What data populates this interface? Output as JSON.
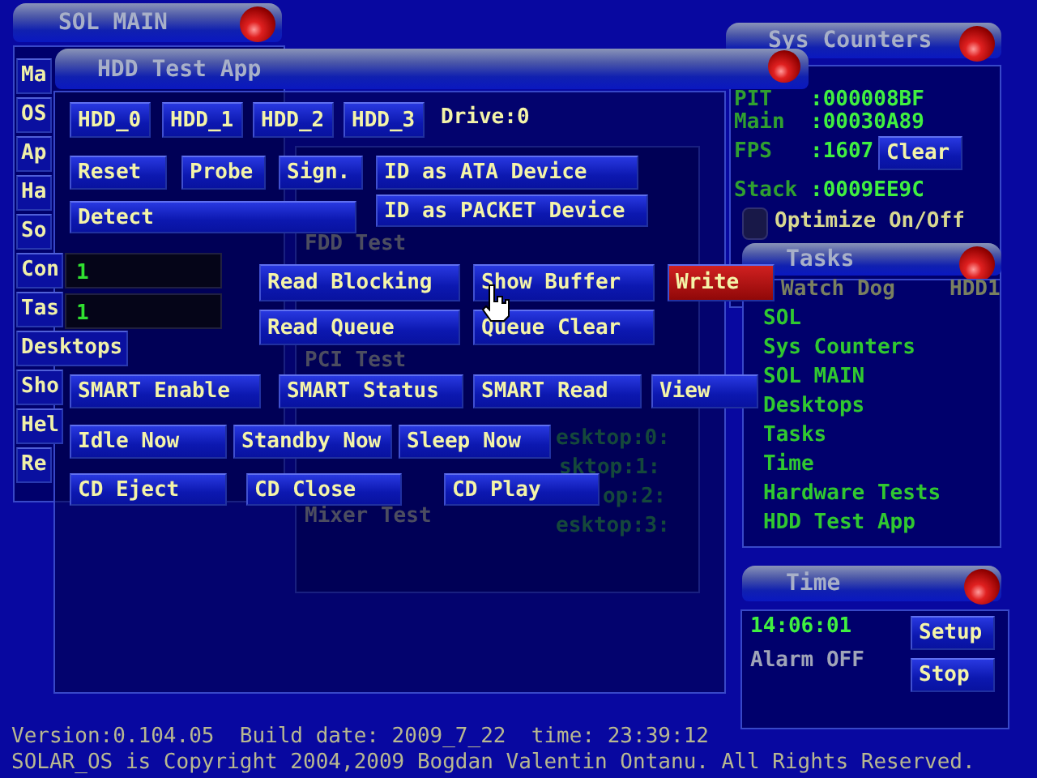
{
  "sol_main": {
    "title": "SOL MAIN",
    "items": [
      "Ma",
      "OS",
      "Ap",
      "Ha",
      "So",
      "Con",
      "Tas",
      "Desktops",
      "Sho",
      "Hel",
      "Re"
    ]
  },
  "hardware_tests_window": {
    "items": [
      "FDD Test",
      "PCI Test",
      "Mixer Test"
    ]
  },
  "desktops_window": {
    "items": [
      "esktop:0:",
      "sktop:1:",
      "op:2:",
      "esktop:3:"
    ]
  },
  "hdd_test_app": {
    "title": "HDD Test App",
    "drive_buttons": [
      "HDD_0",
      "HDD_1",
      "HDD_2",
      "HDD_3"
    ],
    "drive_label": "Drive:0",
    "buttons": [
      {
        "label": "Reset",
        "kind": "normal"
      },
      {
        "label": "Probe",
        "kind": "normal"
      },
      {
        "label": "Sign.",
        "kind": "normal"
      },
      {
        "label": "ID as ATA Device",
        "kind": "normal"
      },
      {
        "label": "Detect",
        "kind": "normal"
      },
      {
        "label": "ID as PACKET Device",
        "kind": "normal"
      },
      {
        "label": "Read Blocking",
        "kind": "normal"
      },
      {
        "label": "Show Buffer",
        "kind": "normal"
      },
      {
        "label": "Write",
        "kind": "danger"
      },
      {
        "label": "Read Queue",
        "kind": "normal"
      },
      {
        "label": "Queue Clear",
        "kind": "normal"
      },
      {
        "label": "SMART Enable",
        "kind": "normal"
      },
      {
        "label": "SMART Status",
        "kind": "normal"
      },
      {
        "label": "SMART Read",
        "kind": "normal"
      },
      {
        "label": "View",
        "kind": "normal"
      },
      {
        "label": "Idle Now",
        "kind": "normal"
      },
      {
        "label": "Standby Now",
        "kind": "normal"
      },
      {
        "label": "Sleep Now",
        "kind": "normal"
      },
      {
        "label": "CD Eject",
        "kind": "normal"
      },
      {
        "label": "CD Close",
        "kind": "normal"
      },
      {
        "label": "CD Play",
        "kind": "normal"
      }
    ],
    "outputs": [
      "1",
      "1"
    ]
  },
  "sys_counters": {
    "title": "Sys Counters",
    "counters": [
      {
        "label": "PIT",
        "value": ":000008BF"
      },
      {
        "label": "Main",
        "value": ":00030A89"
      },
      {
        "label": "FPS",
        "value": ":1607"
      },
      {
        "label": "Stack",
        "value": ":0009EE9C"
      }
    ],
    "clear_button": "Clear",
    "optimize": {
      "label": "Optimize On/Off",
      "checked": false
    }
  },
  "tasks": {
    "title": "Tasks",
    "top_row": [
      "Watch Dog",
      "HDD1"
    ],
    "items": [
      "SOL",
      "Sys Counters",
      "SOL MAIN",
      "Desktops",
      "Tasks",
      "Time",
      "Hardware Tests",
      "HDD Test App"
    ]
  },
  "time": {
    "title": "Time",
    "clock": "14:06:01",
    "alarm": "Alarm OFF",
    "buttons": [
      "Setup",
      "Stop"
    ]
  },
  "status": [
    "Version:0.104.05  Build date: 2009_7_22  time: 23:39:12",
    "SOLAR_OS is Copyright 2004,2009 Bogdan Valentin Ontanu. All Rights Reserved."
  ]
}
